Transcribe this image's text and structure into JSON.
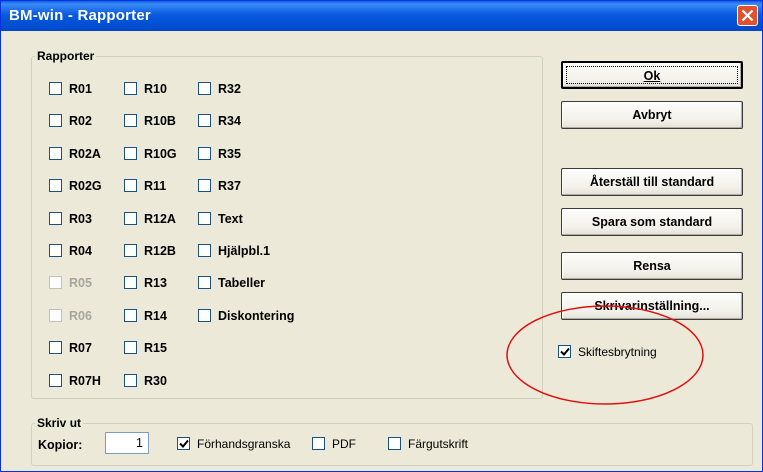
{
  "window": {
    "title": "BM-win - Rapporter"
  },
  "reports": {
    "legend": "Rapporter",
    "items": [
      {
        "label": "R01",
        "disabled": false,
        "checked": false
      },
      {
        "label": "R02",
        "disabled": false,
        "checked": false
      },
      {
        "label": "R02A",
        "disabled": false,
        "checked": false
      },
      {
        "label": "R02G",
        "disabled": false,
        "checked": false
      },
      {
        "label": "R03",
        "disabled": false,
        "checked": false
      },
      {
        "label": "R04",
        "disabled": false,
        "checked": false
      },
      {
        "label": "R05",
        "disabled": true,
        "checked": false
      },
      {
        "label": "R06",
        "disabled": true,
        "checked": false
      },
      {
        "label": "R07",
        "disabled": false,
        "checked": false
      },
      {
        "label": "R07H",
        "disabled": false,
        "checked": false
      },
      {
        "label": "R10",
        "disabled": false,
        "checked": false
      },
      {
        "label": "R10B",
        "disabled": false,
        "checked": false
      },
      {
        "label": "R10G",
        "disabled": false,
        "checked": false
      },
      {
        "label": "R11",
        "disabled": false,
        "checked": false
      },
      {
        "label": "R12A",
        "disabled": false,
        "checked": false
      },
      {
        "label": "R12B",
        "disabled": false,
        "checked": false
      },
      {
        "label": "R13",
        "disabled": false,
        "checked": false
      },
      {
        "label": "R14",
        "disabled": false,
        "checked": false
      },
      {
        "label": "R15",
        "disabled": false,
        "checked": false
      },
      {
        "label": "R30",
        "disabled": false,
        "checked": false
      },
      {
        "label": "R32",
        "disabled": false,
        "checked": false
      },
      {
        "label": "R34",
        "disabled": false,
        "checked": false
      },
      {
        "label": "R35",
        "disabled": false,
        "checked": false
      },
      {
        "label": "R37",
        "disabled": false,
        "checked": false
      },
      {
        "label": "Text",
        "disabled": false,
        "checked": false
      },
      {
        "label": "Hjälpbl.1",
        "disabled": false,
        "checked": false
      },
      {
        "label": "Tabeller",
        "disabled": false,
        "checked": false
      },
      {
        "label": "Diskontering",
        "disabled": false,
        "checked": false
      }
    ]
  },
  "buttons": {
    "ok": "Ok",
    "cancel": "Avbryt",
    "reset": "Återställ till standard",
    "save": "Spara som standard",
    "clear": "Rensa",
    "printer": "Skrivarinställning..."
  },
  "page_break": {
    "label": "Skiftesbrytning",
    "checked": true
  },
  "print": {
    "legend": "Skriv ut",
    "copies_label": "Kopior:",
    "copies_value": "1",
    "preview_label": "Förhandsgranska",
    "preview_checked": true,
    "pdf_label": "PDF",
    "pdf_checked": false,
    "color_label": "Färgutskrift",
    "color_checked": false
  },
  "colors": {
    "titlebar": "#0a5ae0",
    "annotation": "#e01010",
    "dialog_bg": "#ece9d8"
  }
}
